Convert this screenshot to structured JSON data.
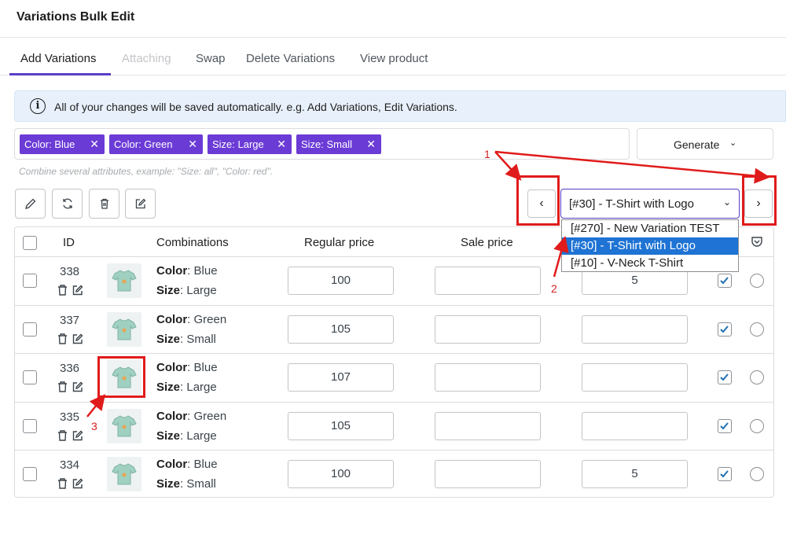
{
  "page_title": "Variations Bulk Edit",
  "tabs": [
    "Add Variations",
    "Attaching",
    "Swap",
    "Delete Variations",
    "View product"
  ],
  "notice": "All of your changes will be saved automatically. e.g. Add Variations, Edit Variations.",
  "chips": [
    "Color: Blue",
    "Color: Green",
    "Size: Large",
    "Size: Small"
  ],
  "chip_remove_glyph": "✕",
  "generate_label": "Generate",
  "hint": "Combine several attributes, example: \"Size: all\", \"Color: red\".",
  "product_select": {
    "value": "[#30] - T-Shirt with Logo",
    "options": [
      "[#270] - New Variation TEST",
      "[#30] - T-Shirt with Logo",
      "[#10] - V-Neck T-Shirt"
    ],
    "selected_index": 1
  },
  "nav": {
    "prev": "‹",
    "next": "›"
  },
  "columns": {
    "id": "ID",
    "combinations": "Combinations",
    "regular_price": "Regular price",
    "sale_price": "Sale price"
  },
  "rows": [
    {
      "id": "338",
      "attrs": [
        {
          "k": "Color",
          "v": "Blue"
        },
        {
          "k": "Size",
          "v": "Large"
        }
      ],
      "regular": "100",
      "sale": "",
      "stock": "5",
      "checked": true
    },
    {
      "id": "337",
      "attrs": [
        {
          "k": "Color",
          "v": "Green"
        },
        {
          "k": "Size",
          "v": "Small"
        }
      ],
      "regular": "105",
      "sale": "",
      "stock": "",
      "checked": true
    },
    {
      "id": "336",
      "attrs": [
        {
          "k": "Color",
          "v": "Blue"
        },
        {
          "k": "Size",
          "v": "Large"
        }
      ],
      "regular": "107",
      "sale": "",
      "stock": "",
      "checked": true
    },
    {
      "id": "335",
      "attrs": [
        {
          "k": "Color",
          "v": "Green"
        },
        {
          "k": "Size",
          "v": "Large"
        }
      ],
      "regular": "105",
      "sale": "",
      "stock": "",
      "checked": true
    },
    {
      "id": "334",
      "attrs": [
        {
          "k": "Color",
          "v": "Blue"
        },
        {
          "k": "Size",
          "v": "Small"
        }
      ],
      "regular": "100",
      "sale": "",
      "stock": "5",
      "checked": true
    }
  ],
  "annotations": [
    "1",
    "2",
    "3"
  ],
  "colors": {
    "accent": "#5b3dc8",
    "chip": "#6b3bd6",
    "annotation": "#e01b1b",
    "notice_bg": "#e8f1fb",
    "selected_option": "#1e73d4"
  },
  "icons": [
    "info-icon",
    "pencil-icon",
    "refresh-icon",
    "trash-icon",
    "edit-square-icon",
    "chevron-left-icon",
    "chevron-right-icon",
    "chevron-down-icon",
    "tshirt-icon",
    "shield-icon"
  ]
}
